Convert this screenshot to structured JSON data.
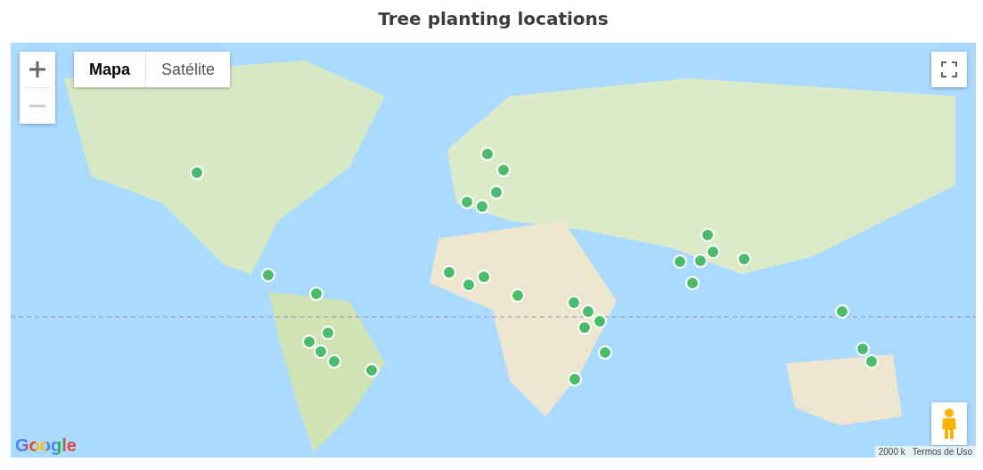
{
  "title": "Tree planting locations",
  "map": {
    "zoom": {
      "zoom_in_disabled": false,
      "zoom_out_disabled": true
    },
    "map_types": [
      {
        "label": "Mapa",
        "selected": true
      },
      {
        "label": "Satélite",
        "selected": false
      }
    ],
    "logo": "Google",
    "scale": "2000 k",
    "terms_link": "Termos de Uso"
  }
}
